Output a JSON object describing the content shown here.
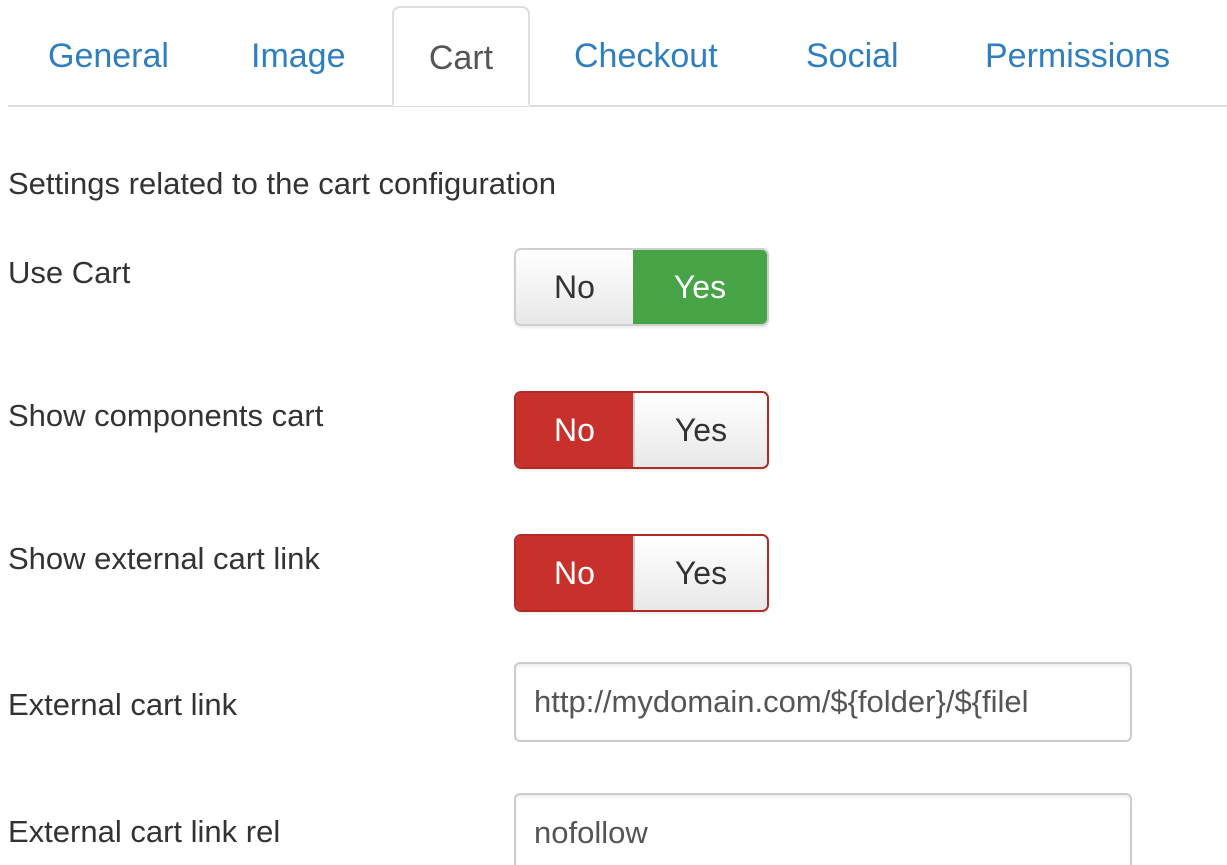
{
  "tabs": [
    {
      "label": "General",
      "active": false
    },
    {
      "label": "Image",
      "active": false
    },
    {
      "label": "Cart",
      "active": true
    },
    {
      "label": "Checkout",
      "active": false
    },
    {
      "label": "Social",
      "active": false
    },
    {
      "label": "Permissions",
      "active": false
    }
  ],
  "description": "Settings related to the cart configuration",
  "fields": {
    "use_cart": {
      "label": "Use Cart",
      "no": "No",
      "yes": "Yes",
      "selected": "Yes"
    },
    "show_components_cart": {
      "label": "Show components cart",
      "no": "No",
      "yes": "Yes",
      "selected": "No"
    },
    "show_external_cart_link": {
      "label": "Show external cart link",
      "no": "No",
      "yes": "Yes",
      "selected": "No"
    },
    "external_cart_link": {
      "label": "External cart link",
      "value": "http://mydomain.com/${folder}/${filel"
    },
    "external_cart_link_rel": {
      "label": "External cart link rel",
      "value": "nofollow"
    }
  },
  "colors": {
    "tab_link": "#2f7ec0",
    "yes_active": "#47a446",
    "no_active": "#c8302c"
  }
}
